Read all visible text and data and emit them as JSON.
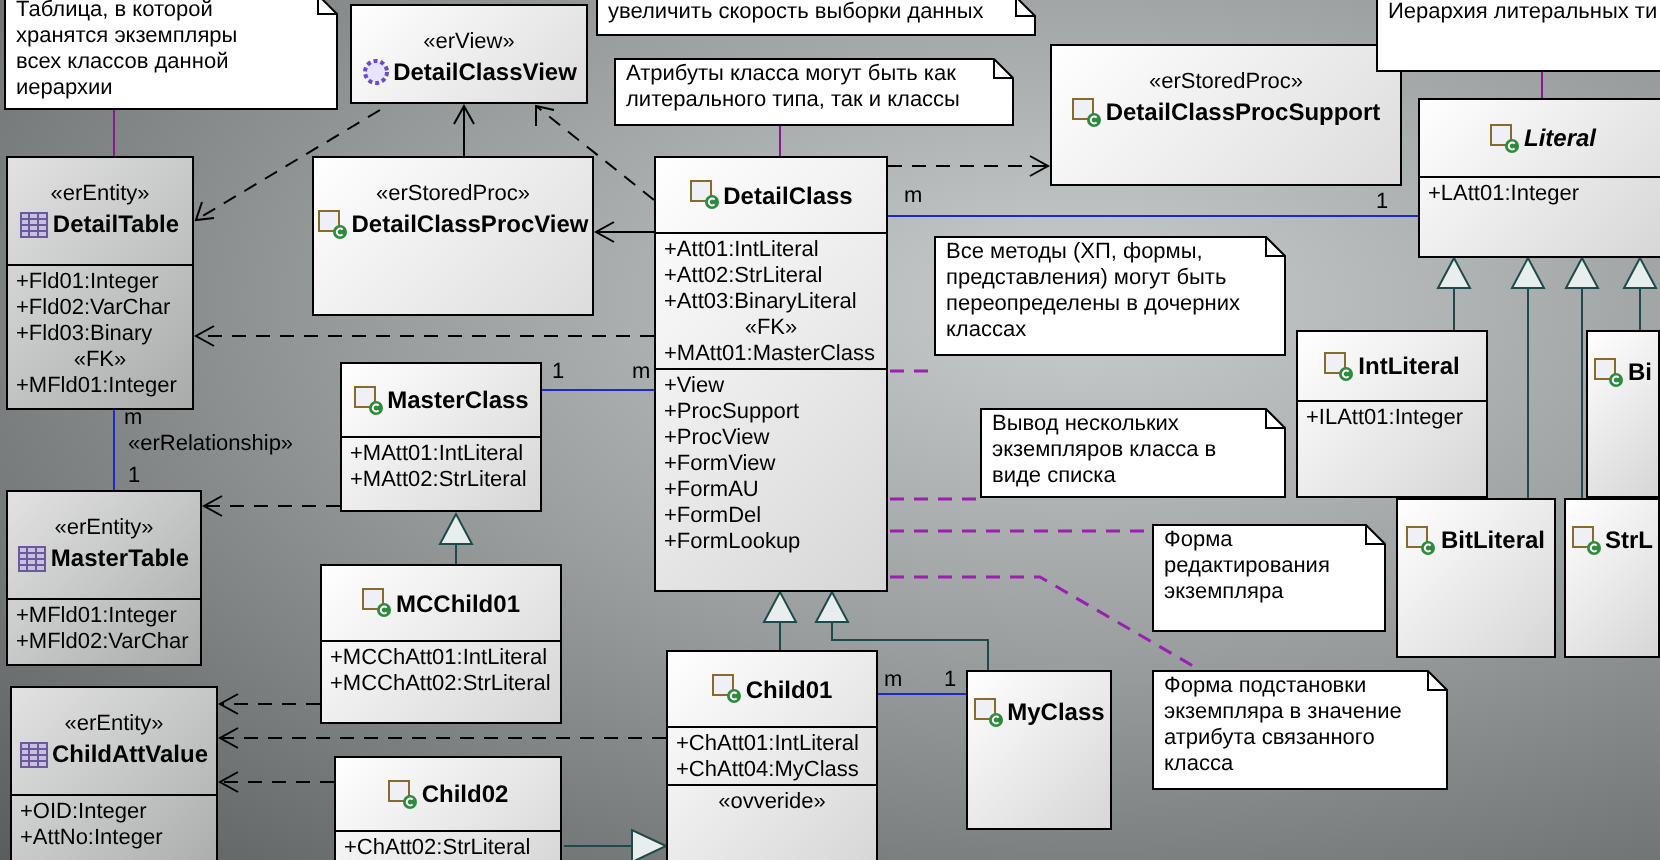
{
  "notes": [
    {
      "lines": [
        "Таблица, в которой",
        "хранятся экземпляры",
        "всех классов данной",
        "иерархии"
      ]
    },
    {
      "lines": [
        "увеличить скорость выборки данных"
      ]
    },
    {
      "lines": [
        "Атрибуты класса могут быть как",
        "литерального типа, так и классы"
      ]
    },
    {
      "lines": [
        "Иерархия литеральных ти"
      ]
    },
    {
      "lines": [
        "Все методы (ХП, формы,",
        "представления) могут быть",
        "переопределены в дочерних",
        "классах"
      ]
    },
    {
      "lines": [
        "Вывод нескольких",
        "экземпляров класса в",
        "виде списка"
      ]
    },
    {
      "lines": [
        "Форма",
        "редактирования",
        "экземпляра"
      ]
    },
    {
      "lines": [
        "Форма подстановки",
        "экземпляра в значение",
        "атрибута связанного",
        "класса"
      ]
    }
  ],
  "classes": [
    {
      "kind": "view",
      "stereotype": "«erView»",
      "name": "DetailClassView",
      "abstract": false
    },
    {
      "kind": "entity",
      "stereotype": "«erEntity»",
      "name": "DetailTable",
      "abstract": false,
      "compartments": [
        [
          {
            "kind": "member",
            "text": "+Fld01:Integer"
          },
          {
            "kind": "member",
            "text": "+Fld02:VarChar"
          },
          {
            "kind": "member",
            "text": "+Fld03:Binary"
          },
          {
            "kind": "stereotype",
            "text": "«FK»"
          },
          {
            "kind": "member",
            "text": "+MFld01:Integer"
          }
        ]
      ]
    },
    {
      "kind": "stored_proc",
      "stereotype": "«erStoredProc»",
      "name": "DetailClassProcView",
      "abstract": false
    },
    {
      "kind": "stored_proc",
      "stereotype": "«erStoredProc»",
      "name": "DetailClassProcSupport",
      "abstract": false
    },
    {
      "kind": "class",
      "name": "DetailClass",
      "abstract": false,
      "compartments": [
        [
          {
            "kind": "member",
            "text": "+Att01:IntLiteral"
          },
          {
            "kind": "member",
            "text": "+Att02:StrLiteral"
          },
          {
            "kind": "member",
            "text": "+Att03:BinaryLiteral"
          },
          {
            "kind": "stereotype",
            "text": "«FK»"
          },
          {
            "kind": "member",
            "text": "+MAtt01:MasterClass"
          }
        ],
        [
          {
            "kind": "member",
            "text": "+View"
          },
          {
            "kind": "member",
            "text": "+ProcSupport"
          },
          {
            "kind": "member",
            "text": "+ProcView"
          },
          {
            "kind": "member",
            "text": "+FormView"
          },
          {
            "kind": "member",
            "text": "+FormAU"
          },
          {
            "kind": "member",
            "text": "+FormDel"
          },
          {
            "kind": "member",
            "text": "+FormLookup"
          }
        ]
      ]
    },
    {
      "kind": "class",
      "name": "Literal",
      "abstract": true,
      "compartments": [
        [
          {
            "kind": "member",
            "text": "+LAtt01:Integer"
          }
        ]
      ]
    },
    {
      "kind": "class",
      "name": "IntLiteral",
      "abstract": false,
      "compartments": [
        [
          {
            "kind": "member",
            "text": "+ILAtt01:Integer"
          }
        ]
      ]
    },
    {
      "kind": "class",
      "name": "Bi",
      "abstract": false
    },
    {
      "kind": "class",
      "name": "MasterClass",
      "abstract": false,
      "compartments": [
        [
          {
            "kind": "member",
            "text": "+MAtt01:IntLiteral"
          },
          {
            "kind": "member",
            "text": "+MAtt02:StrLiteral"
          }
        ]
      ]
    },
    {
      "kind": "entity",
      "stereotype": "«erEntity»",
      "name": "MasterTable",
      "abstract": false,
      "compartments": [
        [
          {
            "kind": "member",
            "text": "+MFld01:Integer"
          },
          {
            "kind": "member",
            "text": "+MFld02:VarChar"
          }
        ]
      ]
    },
    {
      "kind": "class",
      "name": "BitLiteral",
      "abstract": false
    },
    {
      "kind": "class",
      "name": "StrL",
      "abstract": false
    },
    {
      "kind": "class",
      "name": "MCChild01",
      "abstract": false,
      "compartments": [
        [
          {
            "kind": "member",
            "text": "+MCChAtt01:IntLiteral"
          },
          {
            "kind": "member",
            "text": "+MCChAtt02:StrLiteral"
          }
        ]
      ]
    },
    {
      "kind": "entity",
      "stereotype": "«erEntity»",
      "name": "ChildAttValue",
      "abstract": false,
      "compartments": [
        [
          {
            "kind": "member",
            "text": "+OID:Integer"
          },
          {
            "kind": "member",
            "text": "+AttNo:Integer"
          }
        ]
      ]
    },
    {
      "kind": "class",
      "name": "Child01",
      "abstract": false,
      "compartments": [
        [
          {
            "kind": "member",
            "text": "+ChAtt01:IntLiteral"
          },
          {
            "kind": "member",
            "text": "+ChAtt04:MyClass"
          }
        ],
        [
          {
            "kind": "stereotype",
            "text": "«ovveride»"
          }
        ]
      ]
    },
    {
      "kind": "class",
      "name": "MyClass",
      "abstract": false
    },
    {
      "kind": "class",
      "name": "Child02",
      "abstract": false,
      "compartments": [
        [
          {
            "kind": "member",
            "text": "+ChAtt02:StrLiteral"
          }
        ]
      ]
    }
  ],
  "labels": [
    {
      "text": "m"
    },
    {
      "text": "1"
    },
    {
      "text": "1"
    },
    {
      "text": "m"
    },
    {
      "text": "m"
    },
    {
      "text": "«erRelationship»"
    },
    {
      "text": "1"
    },
    {
      "text": "m"
    },
    {
      "text": "1"
    }
  ]
}
